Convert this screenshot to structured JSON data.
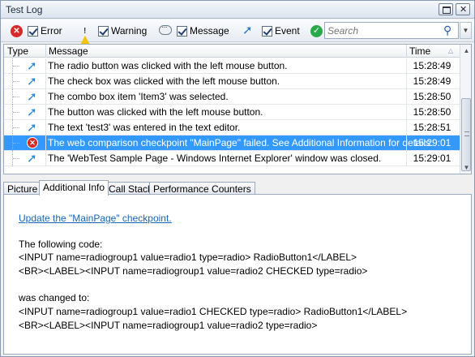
{
  "window": {
    "title": "Test Log"
  },
  "toolbar": {
    "error_label": "Error",
    "warning_label": "Warning",
    "message_label": "Message",
    "event_label": "Event",
    "search_placeholder": "Search"
  },
  "grid": {
    "columns": {
      "type": "Type",
      "message": "Message",
      "time": "Time"
    },
    "rows": [
      {
        "kind": "event",
        "message": "The radio button was clicked with the left mouse button.",
        "time": "15:28:49"
      },
      {
        "kind": "event",
        "message": "The check box was clicked with the left mouse button.",
        "time": "15:28:49"
      },
      {
        "kind": "event",
        "message": "The combo box item 'Item3' was selected.",
        "time": "15:28:50"
      },
      {
        "kind": "event",
        "message": "The button was clicked with the left mouse button.",
        "time": "15:28:50"
      },
      {
        "kind": "event",
        "message": "The text 'test3' was entered in the text editor.",
        "time": "15:28:51"
      },
      {
        "kind": "error",
        "message": "The web comparison checkpoint \"MainPage\" failed. See Additional Information for details.",
        "time": "15:29:01"
      },
      {
        "kind": "event",
        "message": "The 'WebTest Sample Page - Windows Internet Explorer' window was closed.",
        "time": "15:29:01"
      }
    ]
  },
  "tabs": [
    "Picture",
    "Additional Info",
    "Call Stack",
    "Performance Counters"
  ],
  "details": {
    "link": "Update the \"MainPage\" checkpoint.",
    "line1": "The following code:",
    "line2": "<INPUT name=radiogroup1 value=radio1 type=radio> RadioButton1</LABEL>",
    "line3": "<BR><LABEL><INPUT name=radiogroup1 value=radio2 CHECKED type=radio>",
    "line4": "was changed to:",
    "line5": "<INPUT name=radiogroup1 value=radio1 CHECKED type=radio> RadioButton1</LABEL>",
    "line6": "<BR><LABEL><INPUT name=radiogroup1 value=radio2 type=radio>"
  },
  "colors": {
    "selection": "#3399ff",
    "link": "#1566b8",
    "error": "#d42a2a"
  }
}
